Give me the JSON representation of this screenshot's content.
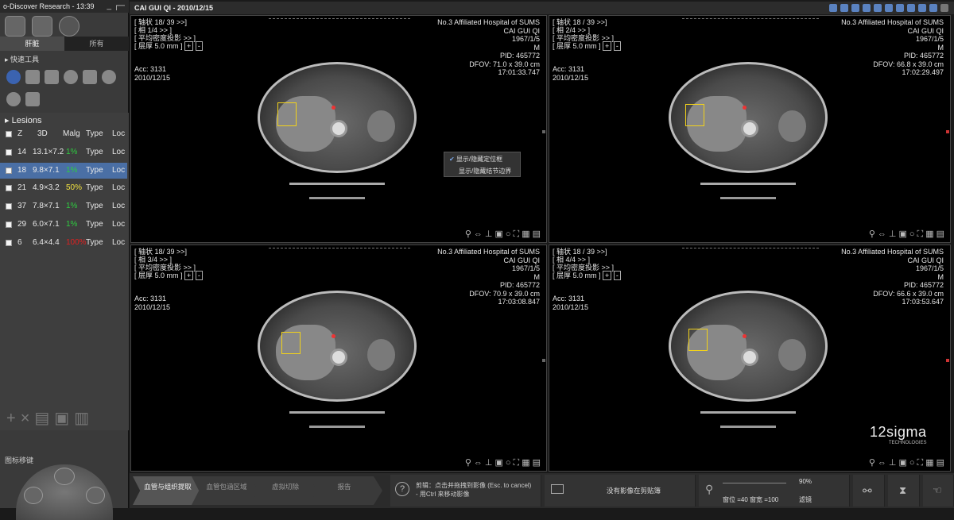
{
  "app": {
    "title": "o-Discover Research - 13:39",
    "win_controls": "_ ┌─"
  },
  "left": {
    "tabs": [
      "肝脏",
      "所有"
    ],
    "quick_tools": "快速工具",
    "lesions": {
      "title": "Lesions",
      "headers": [
        "Z",
        "3D",
        "Malg",
        "Type",
        "Loc"
      ],
      "rows": [
        {
          "z": "14",
          "d3": "13.1×7.2",
          "malg": "1%",
          "type": "Type",
          "loc": "Loc",
          "malg_color": "#2ecc40"
        },
        {
          "z": "18",
          "d3": "9.8×7.1",
          "malg": "1%",
          "type": "Type",
          "loc": "Loc",
          "malg_color": "#2ecc40"
        },
        {
          "z": "21",
          "d3": "4.9×3.2",
          "malg": "50%",
          "type": "Type",
          "loc": "Loc",
          "malg_color": "#f0e040"
        },
        {
          "z": "37",
          "d3": "7.8×7.1",
          "malg": "1%",
          "type": "Type",
          "loc": "Loc",
          "malg_color": "#2ecc40"
        },
        {
          "z": "29",
          "d3": "6.0×7.1",
          "malg": "1%",
          "type": "Type",
          "loc": "Loc",
          "malg_color": "#2ecc40"
        },
        {
          "z": "6",
          "d3": "6.4×4.4",
          "malg": "100%",
          "type": "Type",
          "loc": "Loc",
          "malg_color": "#e02020"
        }
      ]
    },
    "nav_title": "图标移键"
  },
  "topbar": {
    "title": "CAI GUI QI - 2010/12/15"
  },
  "viewports": [
    {
      "l1": "[ 轴状 18/ 39 >>]",
      "l2": "[ 相 1/4 >> ]",
      "l3": "[ 平均密度投影 >> ]",
      "l4": "[ 层厚 5.0 mm ]",
      "acc": "Acc: 3131",
      "date": "2010/12/15",
      "hosp": "No.3 Affiliated Hospital of SUMS",
      "name": "CAI GUI QI",
      "dob": "1967/1/5",
      "sex": "M",
      "pid": "PID: 465772",
      "dfov": "DFOV: 71.0 x 39.0 cm",
      "time": "17:01:33.747"
    },
    {
      "l1": "[ 轴状 18 / 39 >>]",
      "l2": "[ 相 2/4 >> ]",
      "l3": "[ 平均密度投影 >> ]",
      "l4": "[ 层厚 5.0 mm ]",
      "acc": "Acc: 3131",
      "date": "2010/12/15",
      "hosp": "No.3 Affiliated Hospital of SUMS",
      "name": "CAI GUI QI",
      "dob": "1967/1/5",
      "sex": "M",
      "pid": "PID: 465772",
      "dfov": "DFOV: 66.8 x 39.0 cm",
      "time": "17:02:29.497"
    },
    {
      "l1": "[ 轴状 18/ 39 >>]",
      "l2": "[ 相 3/4 >> ]",
      "l3": "[ 平均密度投影 >> ]",
      "l4": "[ 层厚 5.0 mm ]",
      "acc": "Acc: 3131",
      "date": "2010/12/15",
      "hosp": "No.3 Affiliated Hospital of SUMS",
      "name": "CAI GUI QI",
      "dob": "1967/1/5",
      "sex": "M",
      "pid": "PID: 465772",
      "dfov": "DFOV: 70.9 x 39.0 cm",
      "time": "17:03:08.847"
    },
    {
      "l1": "[ 轴状 18 / 39 >>]",
      "l2": "[ 相 4/4 >> ]",
      "l3": "[ 平均密度投影 >> ]",
      "l4": "[ 层厚 5.0 mm ]",
      "acc": "Acc: 3131",
      "date": "2010/12/15",
      "hosp": "No.3 Affiliated Hospital of SUMS",
      "name": "CAI GUI QI",
      "dob": "1967/1/5",
      "sex": "M",
      "pid": "PID: 465772",
      "dfov": "DFOV: 66.6 x 39.0 cm",
      "time": "17:03:53.647"
    }
  ],
  "context_menu": {
    "item1": "显示/隐藏定位框",
    "item2": "显示/隐藏结节边界"
  },
  "brand": {
    "logo": "12sigma",
    "sub": "TECHNOLOGIES"
  },
  "bottom": {
    "steps": [
      "血管与组织提取",
      "血管包涵区域",
      "虚拟切除",
      "报告"
    ],
    "hint": "剪辑：点击并拖拽到影像 (Esc. to cancel) - 用Ctrl 来移动影像",
    "clipboard": "没有影像在剪贴簿",
    "zoom": "90%",
    "window": "窗位 =40 窗宽 =100",
    "filter": "滤镜"
  },
  "colors": {
    "accent": "#4a6fa5",
    "box": "#f2d21a"
  }
}
